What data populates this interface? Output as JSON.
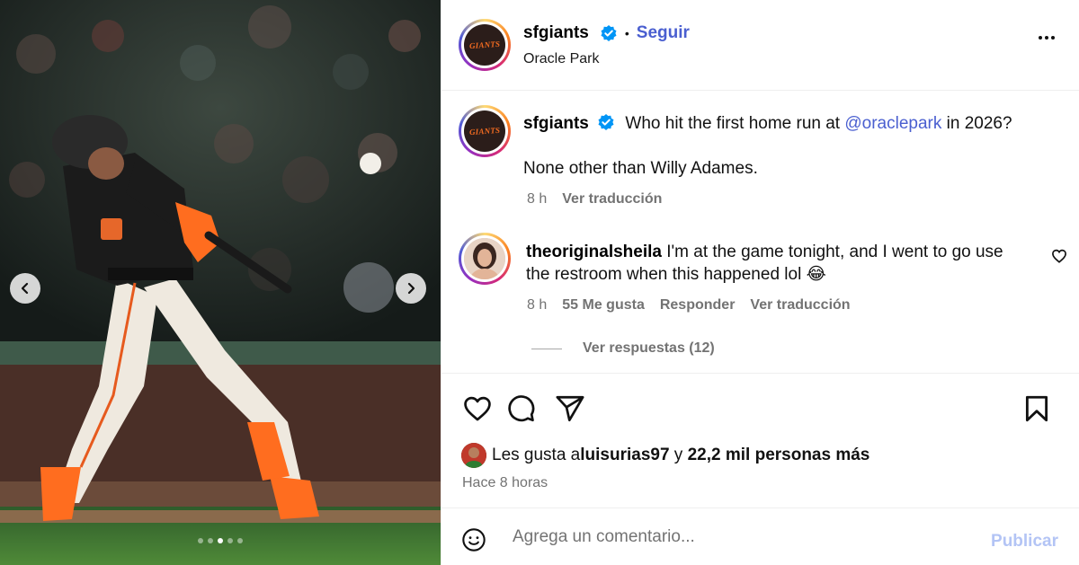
{
  "post": {
    "username": "sfgiants",
    "follow_label": "Seguir",
    "separator": "•",
    "location": "Oracle Park",
    "avatar_text": "GIANTS",
    "carousel": {
      "dot_count": 5,
      "active_index": 2
    }
  },
  "caption": {
    "username": "sfgiants",
    "text_before": "Who hit the first home run at ",
    "mention": "@oraclepark",
    "text_after": " in 2026?",
    "line2": "None other than Willy Adames.",
    "time": "8 h",
    "translate": "Ver traducción"
  },
  "comment": {
    "username": "theoriginalsheila",
    "text": "I'm at the game tonight, and I went to go use the restroom when this happened lol 😂",
    "time": "8 h",
    "likes": "55 Me gusta",
    "reply": "Responder",
    "translate": "Ver traducción",
    "view_replies": "Ver respuestas (12)"
  },
  "likes": {
    "prefix": "Les gusta a ",
    "user": "luisurias97",
    "middle": " y ",
    "others": "22,2 mil personas más",
    "time_ago": "Hace 8 horas"
  },
  "add_comment": {
    "placeholder": "Agrega un comentario...",
    "publish": "Publicar"
  },
  "colors": {
    "link": "#4a5fd0",
    "verified": "#0095f6",
    "publish_disabled": "#b3c4f5",
    "secondary_text": "#737373"
  }
}
